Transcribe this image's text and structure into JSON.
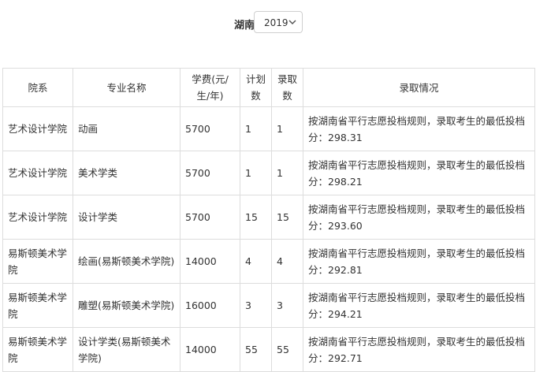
{
  "filter": {
    "province_label": "湖南",
    "year_select": {
      "selected": "2019"
    }
  },
  "table": {
    "headers": [
      "院系",
      "专业名称",
      "学费(元/生/年)",
      "计划数",
      "录取数",
      "录取情况"
    ],
    "rows": [
      [
        "艺术设计学院",
        "动画",
        "5700",
        "1",
        "1",
        "按湖南省平行志愿投档规则，录取考生的最低投档分：298.31"
      ],
      [
        "艺术设计学院",
        "美术学类",
        "5700",
        "1",
        "1",
        "按湖南省平行志愿投档规则，录取考生的最低投档分：298.21"
      ],
      [
        "艺术设计学院",
        "设计学类",
        "5700",
        "15",
        "15",
        "按湖南省平行志愿投档规则，录取考生的最低投档分：293.60"
      ],
      [
        "易斯顿美术学院",
        "绘画(易斯顿美术学院)",
        "14000",
        "4",
        "4",
        "按湖南省平行志愿投档规则，录取考生的最低投档分：292.81"
      ],
      [
        "易斯顿美术学院",
        "雕塑(易斯顿美术学院)",
        "16000",
        "3",
        "3",
        "按湖南省平行志愿投档规则，录取考生的最低投档分：294.21"
      ],
      [
        "易斯顿美术学院",
        "设计学类(易斯顿美术学院)",
        "14000",
        "55",
        "55",
        "按湖南省平行志愿投档规则，录取考生的最低投档分：292.71"
      ]
    ]
  }
}
